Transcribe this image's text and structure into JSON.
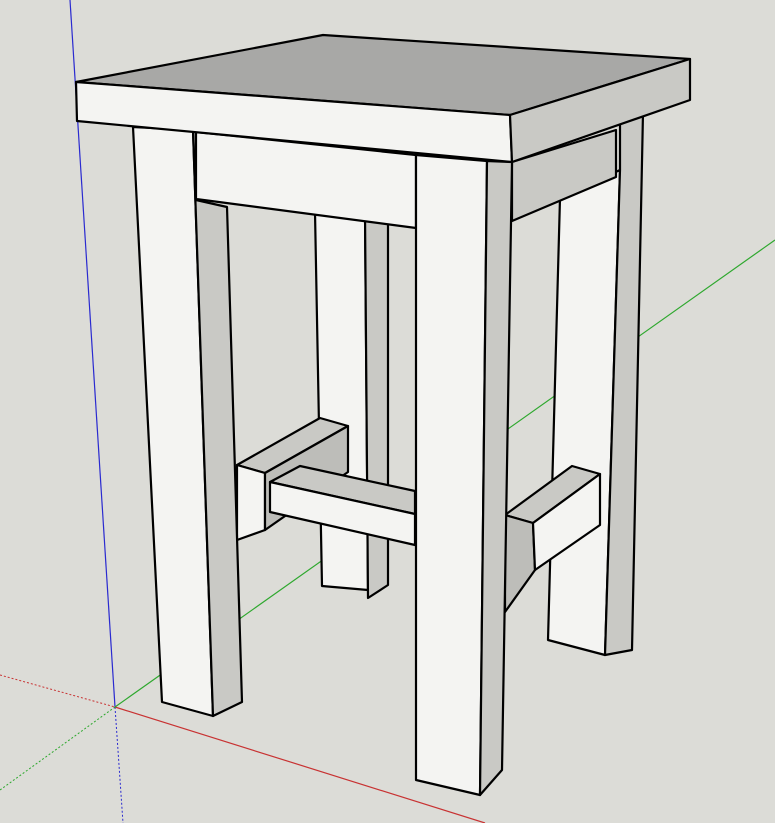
{
  "scene": {
    "background": "#dcdcd7",
    "object": "stool-model",
    "colors": {
      "face_light": "#f4f4f2",
      "face_mid": "#c9c9c5",
      "face_top": "#a8a8a6",
      "axis_red": "#c83232",
      "axis_green": "#2ea82e",
      "axis_blue": "#2a2ad0"
    }
  }
}
